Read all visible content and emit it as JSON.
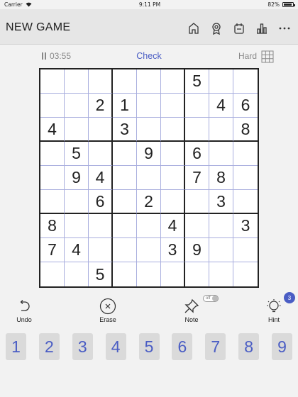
{
  "status_bar": {
    "carrier": "Carrier",
    "time": "9:11 PM",
    "battery": "82%"
  },
  "header": {
    "title": "NEW GAME",
    "icons": [
      "home-icon",
      "award-icon",
      "calendar-icon",
      "stats-icon",
      "more-icon"
    ]
  },
  "infobar": {
    "timer": "03:55",
    "check_label": "Check",
    "difficulty": "Hard"
  },
  "board": {
    "cells": [
      [
        "",
        "",
        "",
        "",
        "",
        "",
        "5",
        "",
        ""
      ],
      [
        "",
        "",
        "2",
        "1",
        "",
        "",
        "",
        "4",
        "6"
      ],
      [
        "4",
        "",
        "",
        "3",
        "",
        "",
        "",
        "",
        "8"
      ],
      [
        "",
        "5",
        "",
        "",
        "9",
        "",
        "6",
        "",
        ""
      ],
      [
        "",
        "9",
        "4",
        "",
        "",
        "",
        "7",
        "8",
        ""
      ],
      [
        "",
        "",
        "6",
        "",
        "2",
        "",
        "",
        "3",
        ""
      ],
      [
        "8",
        "",
        "",
        "",
        "",
        "4",
        "",
        "",
        "3"
      ],
      [
        "7",
        "4",
        "",
        "",
        "",
        "3",
        "9",
        "",
        ""
      ],
      [
        "",
        "",
        "5",
        "",
        "",
        "",
        "",
        "",
        ""
      ]
    ]
  },
  "tools": {
    "undo": "Undo",
    "erase": "Erase",
    "note": "Note",
    "note_toggle": "off",
    "hint": "Hint",
    "hint_count": "3"
  },
  "numpad": [
    "1",
    "2",
    "3",
    "4",
    "5",
    "6",
    "7",
    "8",
    "9"
  ],
  "colors": {
    "accent": "#4a5dc4",
    "board_thin_line": "#a9aede",
    "header_bg": "#e6e6e6"
  }
}
